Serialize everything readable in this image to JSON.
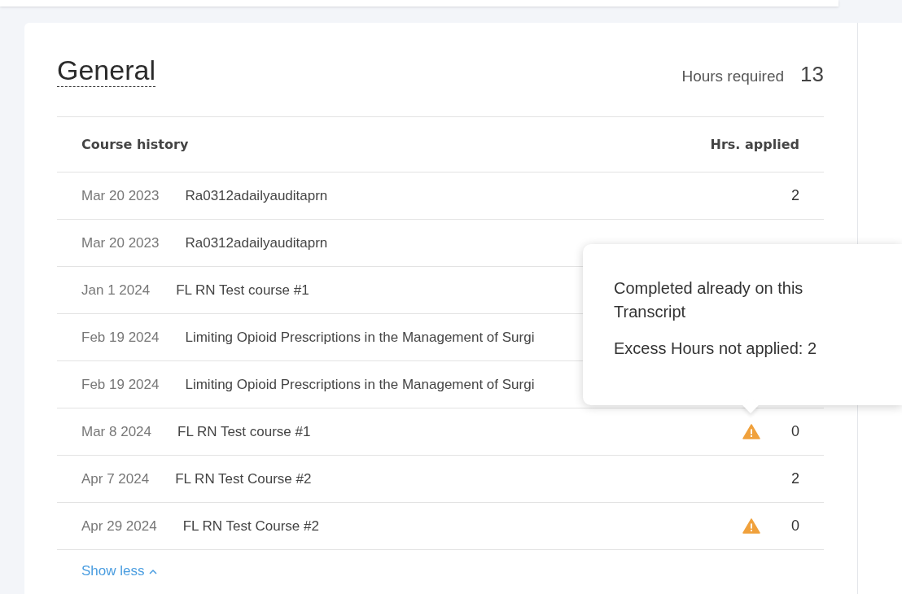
{
  "section": {
    "title": "General",
    "hours_label": "Hours required",
    "hours_value": "13"
  },
  "table": {
    "columns": [
      "Course history",
      "Hrs. applied"
    ],
    "rows": [
      {
        "date": "Mar 20 2023",
        "course": "Ra0312adailyauditaprn",
        "hours": "2",
        "warning": false
      },
      {
        "date": "Mar 20 2023",
        "course": "Ra0312adailyauditaprn",
        "warning": false
      },
      {
        "date": "Jan 1 2024",
        "course": "FL RN Test course #1",
        "warning": false
      },
      {
        "date": "Feb 19 2024",
        "course": "Limiting Opioid Prescriptions in the Management of Surgi",
        "warning": false
      },
      {
        "date": "Feb 19 2024",
        "course": "Limiting Opioid Prescriptions in the Management of Surgi",
        "warning": false
      },
      {
        "date": "Mar 8 2024",
        "course": "FL RN Test course #1",
        "hours": "0",
        "warning": true
      },
      {
        "date": "Apr 7 2024",
        "course": "FL RN Test Course #2",
        "hours": "2",
        "warning": false
      },
      {
        "date": "Apr 29 2024",
        "course": "FL RN Test Course #2",
        "hours": "0",
        "warning": true
      }
    ]
  },
  "show_less": "Show less",
  "tooltip": {
    "lines": [
      "Completed already on this Transcript",
      "Excess Hours not applied: 2"
    ]
  }
}
